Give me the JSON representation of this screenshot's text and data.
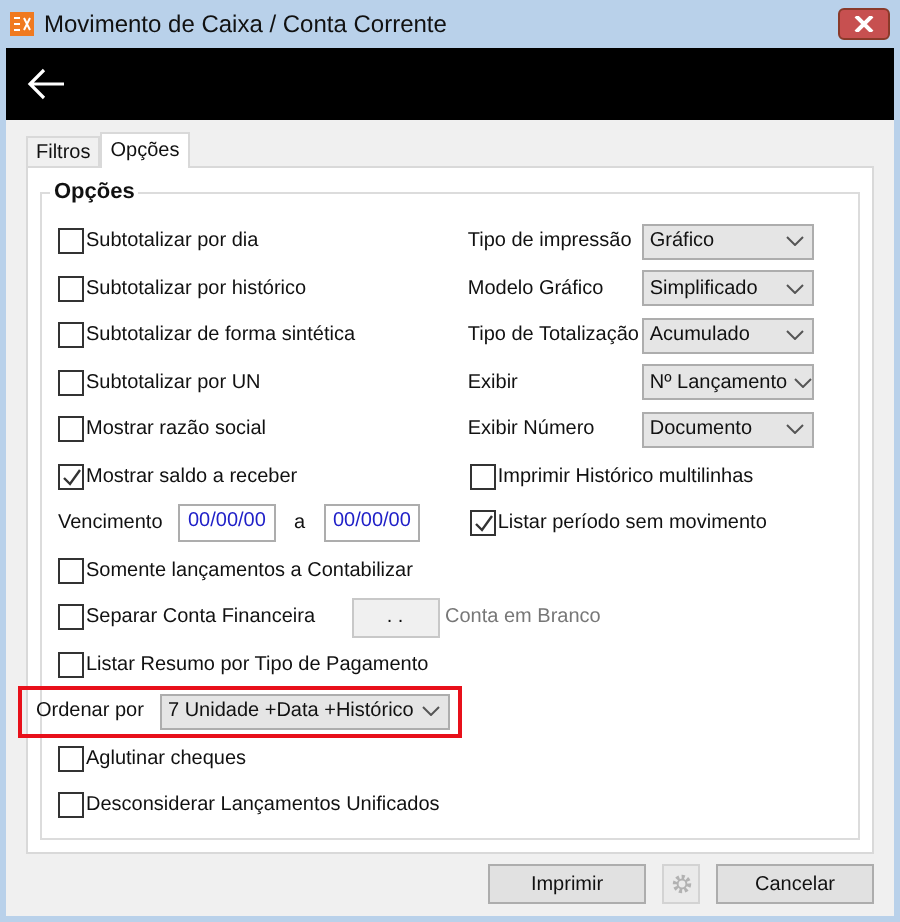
{
  "window": {
    "title": "Movimento de Caixa / Conta Corrente"
  },
  "tabs": [
    {
      "label": "Filtros",
      "selected": false
    },
    {
      "label": "Opções",
      "selected": true
    }
  ],
  "group": {
    "title": "Opções"
  },
  "left": [
    {
      "kind": "checkbox",
      "label": "Subtotalizar por dia",
      "checked": false
    },
    {
      "kind": "checkbox",
      "label": "Subtotalizar por histórico",
      "checked": false
    },
    {
      "kind": "checkbox",
      "label": "Subtotalizar de forma sintética",
      "checked": false
    },
    {
      "kind": "checkbox",
      "label": "Subtotalizar por UN",
      "checked": false
    },
    {
      "kind": "checkbox",
      "label": "Mostrar razão social",
      "checked": false
    },
    {
      "kind": "checkbox",
      "label": "Mostrar saldo a receber",
      "checked": true
    },
    {
      "kind": "date_range",
      "label": "Vencimento",
      "from": "00/00/00",
      "separator": "a",
      "to": "00/00/00"
    }
  ],
  "right": [
    {
      "kind": "select",
      "label": "Tipo de impressão",
      "value": "Gráfico"
    },
    {
      "kind": "select",
      "label": "Modelo Gráfico",
      "value": "Simplificado"
    },
    {
      "kind": "select",
      "label": "Tipo de Totalização",
      "value": "Acumulado"
    },
    {
      "kind": "select",
      "label": "Exibir",
      "value": "Nº Lançamento"
    },
    {
      "kind": "select",
      "label": "Exibir Número",
      "value": "Documento"
    },
    {
      "kind": "checkbox",
      "label": "Imprimir Histórico multilinhas",
      "checked": false
    },
    {
      "kind": "checkbox",
      "label": "Listar período sem movimento",
      "checked": true
    }
  ],
  "bottom": [
    {
      "kind": "checkbox",
      "label": "Somente lançamentos a Contabilizar",
      "checked": false
    },
    {
      "kind": "account",
      "label": "Separar Conta Financeira",
      "checked": false,
      "account_field": {
        "value": ". ."
      },
      "note": "Conta em Branco"
    },
    {
      "kind": "checkbox",
      "label": "Listar Resumo por Tipo de Pagamento",
      "checked": false
    },
    {
      "kind": "select",
      "label": "Ordenar por",
      "value": "7 Unidade +Data +Histórico",
      "highlighted": true
    },
    {
      "kind": "checkbox",
      "label": "Aglutinar cheques",
      "checked": false
    },
    {
      "kind": "checkbox",
      "label": "Desconsiderar Lançamentos Unificados",
      "checked": false
    }
  ],
  "buttons": [
    {
      "kind": "text",
      "label": "Imprimir"
    },
    {
      "kind": "gear",
      "disabled": true
    },
    {
      "kind": "text",
      "label": "Cancelar"
    }
  ]
}
